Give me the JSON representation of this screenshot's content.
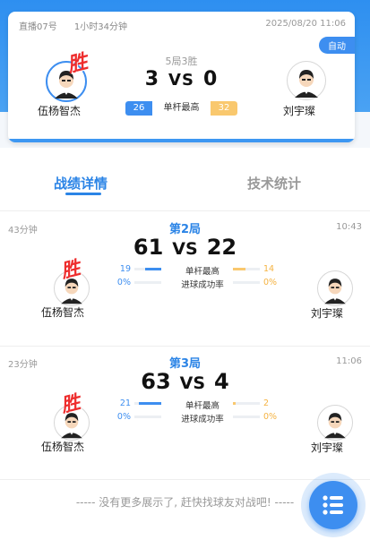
{
  "header": {
    "room": "直播07号",
    "duration": "1小时34分钟",
    "datetime": "2025/08/20 11:06",
    "auto_label": "自动"
  },
  "match": {
    "format": "5局3胜",
    "score_left": "3",
    "score_right": "0",
    "vs": "VS",
    "player_left": "伍杨智杰",
    "player_right": "刘宇璨",
    "win_label": "胜",
    "best_break_label": "单杆最高",
    "best_break_left": "26",
    "best_break_right": "32"
  },
  "tabs": {
    "active": "战绩详情",
    "inactive": "技术统计"
  },
  "games": [
    {
      "elapsed": "43分钟",
      "title": "第2局",
      "clock": "10:43",
      "score_left": "61",
      "score_right": "22",
      "player_left": "伍杨智杰",
      "player_right": "刘宇璨",
      "stats": [
        {
          "label": "单杆最高",
          "left": "19",
          "right": "14",
          "left_frac": 0.6,
          "right_frac": 0.45
        },
        {
          "label": "进球成功率",
          "left": "0%",
          "right": "0%",
          "left_frac": 0,
          "right_frac": 0
        }
      ]
    },
    {
      "elapsed": "23分钟",
      "title": "第3局",
      "clock": "11:06",
      "score_left": "63",
      "score_right": "4",
      "player_left": "伍杨智杰",
      "player_right": "刘宇璨",
      "stats": [
        {
          "label": "单杆最高",
          "left": "21",
          "right": "2",
          "left_frac": 0.85,
          "right_frac": 0.1
        },
        {
          "label": "进球成功率",
          "left": "0%",
          "right": "0%",
          "left_frac": 0,
          "right_frac": 0
        }
      ]
    }
  ],
  "footer": {
    "text": "----- 没有更多展示了, 赶快找球友对战吧! -----"
  },
  "fab": {
    "icon": "list-icon"
  },
  "colors": {
    "primary": "#3d8ef0",
    "accent_orange": "#f9c86e",
    "win_red": "#ee2d2d"
  }
}
